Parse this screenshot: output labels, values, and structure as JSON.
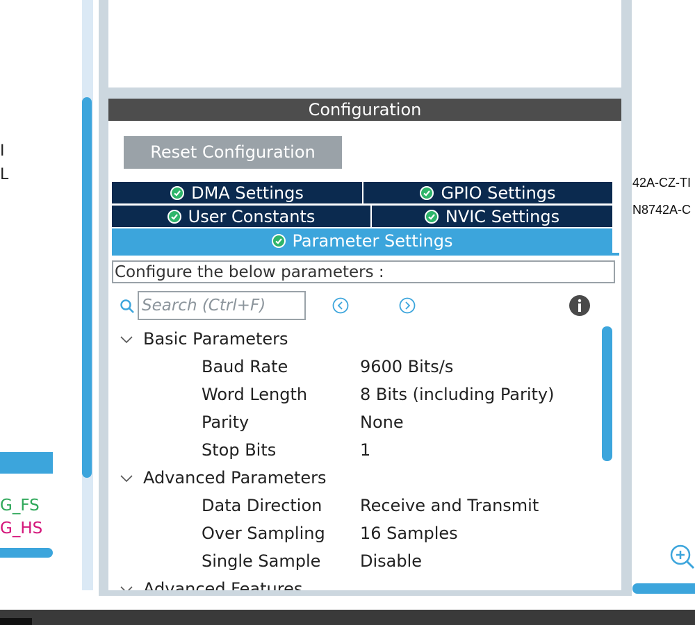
{
  "left_panel": {
    "fragments": [
      "I",
      "L"
    ],
    "list_items": [
      {
        "label": "G_FS",
        "color": "#2fa85a"
      },
      {
        "label": "G_HS",
        "color": "#d4157a"
      }
    ]
  },
  "configuration": {
    "header": "Configuration",
    "reset_label": "Reset Configuration",
    "tabs": [
      {
        "label": "DMA Settings",
        "status": "ok"
      },
      {
        "label": "GPIO Settings",
        "status": "ok"
      },
      {
        "label": "User Constants",
        "status": "ok"
      },
      {
        "label": "NVIC Settings",
        "status": "ok"
      },
      {
        "label": "Parameter Settings",
        "status": "ok",
        "active": true
      }
    ],
    "describe_text": "Configure the below parameters :",
    "search": {
      "placeholder": "Search (Ctrl+F)",
      "value": ""
    },
    "groups": [
      {
        "name": "Basic Parameters",
        "expanded": true,
        "params": [
          {
            "name": "Baud Rate",
            "value": "9600 Bits/s"
          },
          {
            "name": "Word Length",
            "value": "8 Bits (including Parity)"
          },
          {
            "name": "Parity",
            "value": "None"
          },
          {
            "name": "Stop Bits",
            "value": "1"
          }
        ]
      },
      {
        "name": "Advanced Parameters",
        "expanded": true,
        "params": [
          {
            "name": "Data Direction",
            "value": "Receive and Transmit"
          },
          {
            "name": "Over Sampling",
            "value": "16 Samples"
          },
          {
            "name": "Single Sample",
            "value": "Disable"
          }
        ]
      },
      {
        "name": "Advanced Features",
        "expanded": false,
        "params": []
      }
    ]
  },
  "right_panel": {
    "fragments": [
      "42A-CZ-TI",
      "N8742A-C"
    ]
  },
  "colors": {
    "accent": "#3ca5dc",
    "tab_dark": "#0b2a4f",
    "header": "#4d4d4d",
    "check": "#2eb56a"
  },
  "icons": [
    "check-icon",
    "search-icon",
    "previous-icon",
    "next-icon",
    "info-icon",
    "chevron-down-icon",
    "zoom-in-icon"
  ]
}
